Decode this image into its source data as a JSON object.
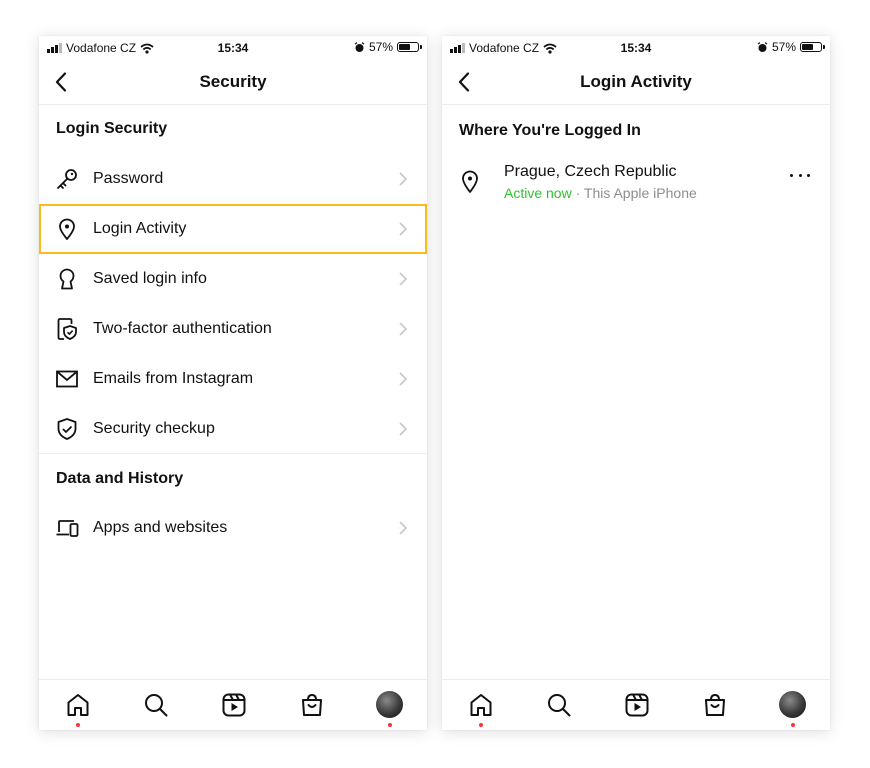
{
  "status_bar": {
    "carrier": "Vodafone CZ",
    "time": "15:34",
    "battery": "57%"
  },
  "left_screen": {
    "title": "Security",
    "section_login_security": "Login Security",
    "items": [
      {
        "label": "Password",
        "icon": "key-icon"
      },
      {
        "label": "Login Activity",
        "icon": "location-pin-icon"
      },
      {
        "label": "Saved login info",
        "icon": "keyhole-icon"
      },
      {
        "label": "Two-factor authentication",
        "icon": "phone-shield-icon"
      },
      {
        "label": "Emails from Instagram",
        "icon": "envelope-icon"
      },
      {
        "label": "Security checkup",
        "icon": "shield-check-icon"
      }
    ],
    "section_data_history": "Data and History",
    "data_items": [
      {
        "label": "Apps and websites",
        "icon": "devices-icon"
      }
    ],
    "highlight_color": "#fbbb1e"
  },
  "right_screen": {
    "title": "Login Activity",
    "section_title": "Where You're Logged In",
    "session": {
      "location": "Prague, Czech Republic",
      "status": "Active now",
      "separator": " · ",
      "device": "This Apple iPhone",
      "status_color": "#2ec22e"
    }
  },
  "tab_bar": {
    "tabs": [
      "home-icon",
      "search-icon",
      "reels-icon",
      "shop-icon",
      "profile-avatar"
    ],
    "notification_dot_color": "#ff3040"
  }
}
